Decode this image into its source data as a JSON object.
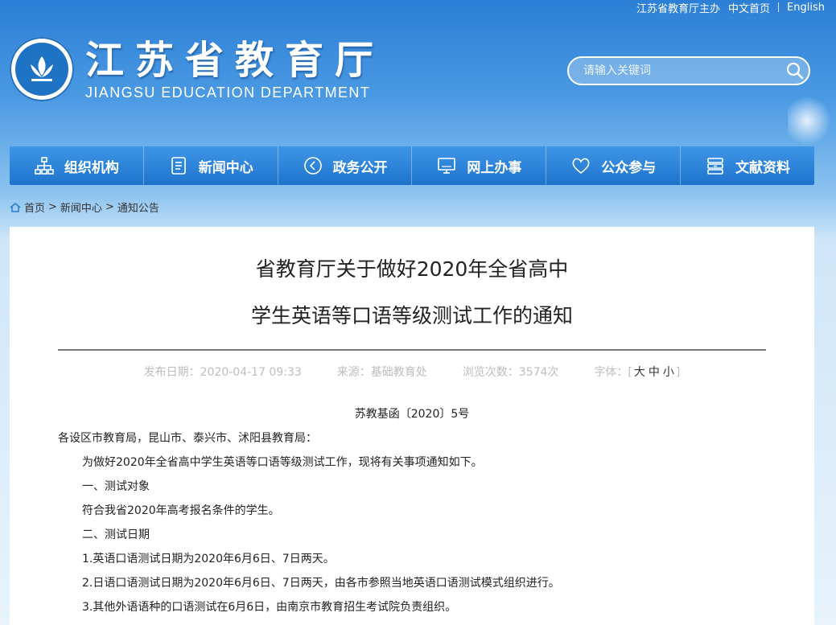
{
  "topbar": {
    "host": "江苏省教育厅主办",
    "chinese": "中文首页",
    "english": "English"
  },
  "header": {
    "site_name_cn": "江苏省教育厅",
    "site_name_en": "JIANGSU EDUCATION DEPARTMENT"
  },
  "search": {
    "placeholder": "请输入关键词"
  },
  "nav": {
    "items": [
      {
        "label": "组织机构",
        "icon": "org-chart-icon"
      },
      {
        "label": "新闻中心",
        "icon": "document-icon"
      },
      {
        "label": "政务公开",
        "icon": "play-icon"
      },
      {
        "label": "网上办事",
        "icon": "monitor-icon"
      },
      {
        "label": "公众参与",
        "icon": "heart-icon"
      },
      {
        "label": "文献资料",
        "icon": "archive-icon"
      }
    ]
  },
  "breadcrumb": {
    "home": "首页",
    "news": "新闻中心",
    "current": "通知公告"
  },
  "article": {
    "title_line1": "省教育厅关于做好2020年全省高中",
    "title_line2": "学生英语等口语等级测试工作的通知",
    "publish_date": "发布日期：2020-04-17 09:33",
    "source": "来源：基础教育处",
    "views": "浏览次数：3574次",
    "font_label": "字体：[",
    "font_large": "大",
    "font_medium": "中",
    "font_small": "小",
    "font_close": "]",
    "doc_number": "苏教基函〔2020〕5号",
    "recipients": "各设区市教育局，昆山市、泰兴市、沭阳县教育局：",
    "intro": "为做好2020年全省高中学生英语等口语等级测试工作，现将有关事项通知如下。",
    "section1_title": "一、测试对象",
    "section1_body": "符合我省2020年高考报名条件的学生。",
    "section2_title": "二、测试日期",
    "item1": "1.英语口语测试日期为2020年6月6日、7日两天。",
    "item2": "2.日语口语测试日期为2020年6月6日、7日两天，由各市参照当地英语口语测试模式组织进行。",
    "item3": "3.其他外语语种的口语测试在6月6日，由南京市教育招生考试院负责组织。"
  },
  "colors": {
    "nav_top": "#3f95e6",
    "nav_bottom": "#1e74cc",
    "brand_blue": "#1e73c4"
  }
}
